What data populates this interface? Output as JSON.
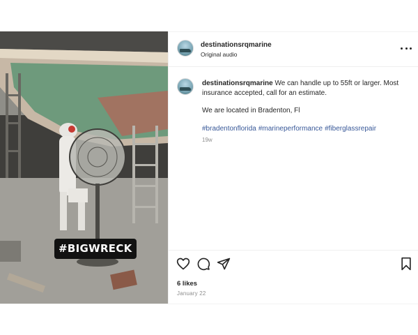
{
  "post": {
    "username": "destinationsrqmarine",
    "audio": "Original audio",
    "video_caption": "#BIGWRECK",
    "comment": {
      "username": "destinationsrqmarine",
      "text": "We can handle up to 55ft or larger. Most insurance accepted, call for an estimate.",
      "location_line": "We are located in Bradenton, Fl",
      "hashtags": [
        "#bradentonflorida",
        "#marineperformance",
        "#fiberglassrepair"
      ],
      "age": "19w"
    },
    "likes": "6 likes",
    "date": "January 22"
  },
  "colors": {
    "hashtag": "#385898",
    "muted": "#8e8e8e",
    "text": "#262626",
    "hull_green": "#6e9a7c"
  },
  "icons": [
    "more-options-icon",
    "heart-icon",
    "comment-icon",
    "share-icon",
    "bookmark-icon"
  ]
}
